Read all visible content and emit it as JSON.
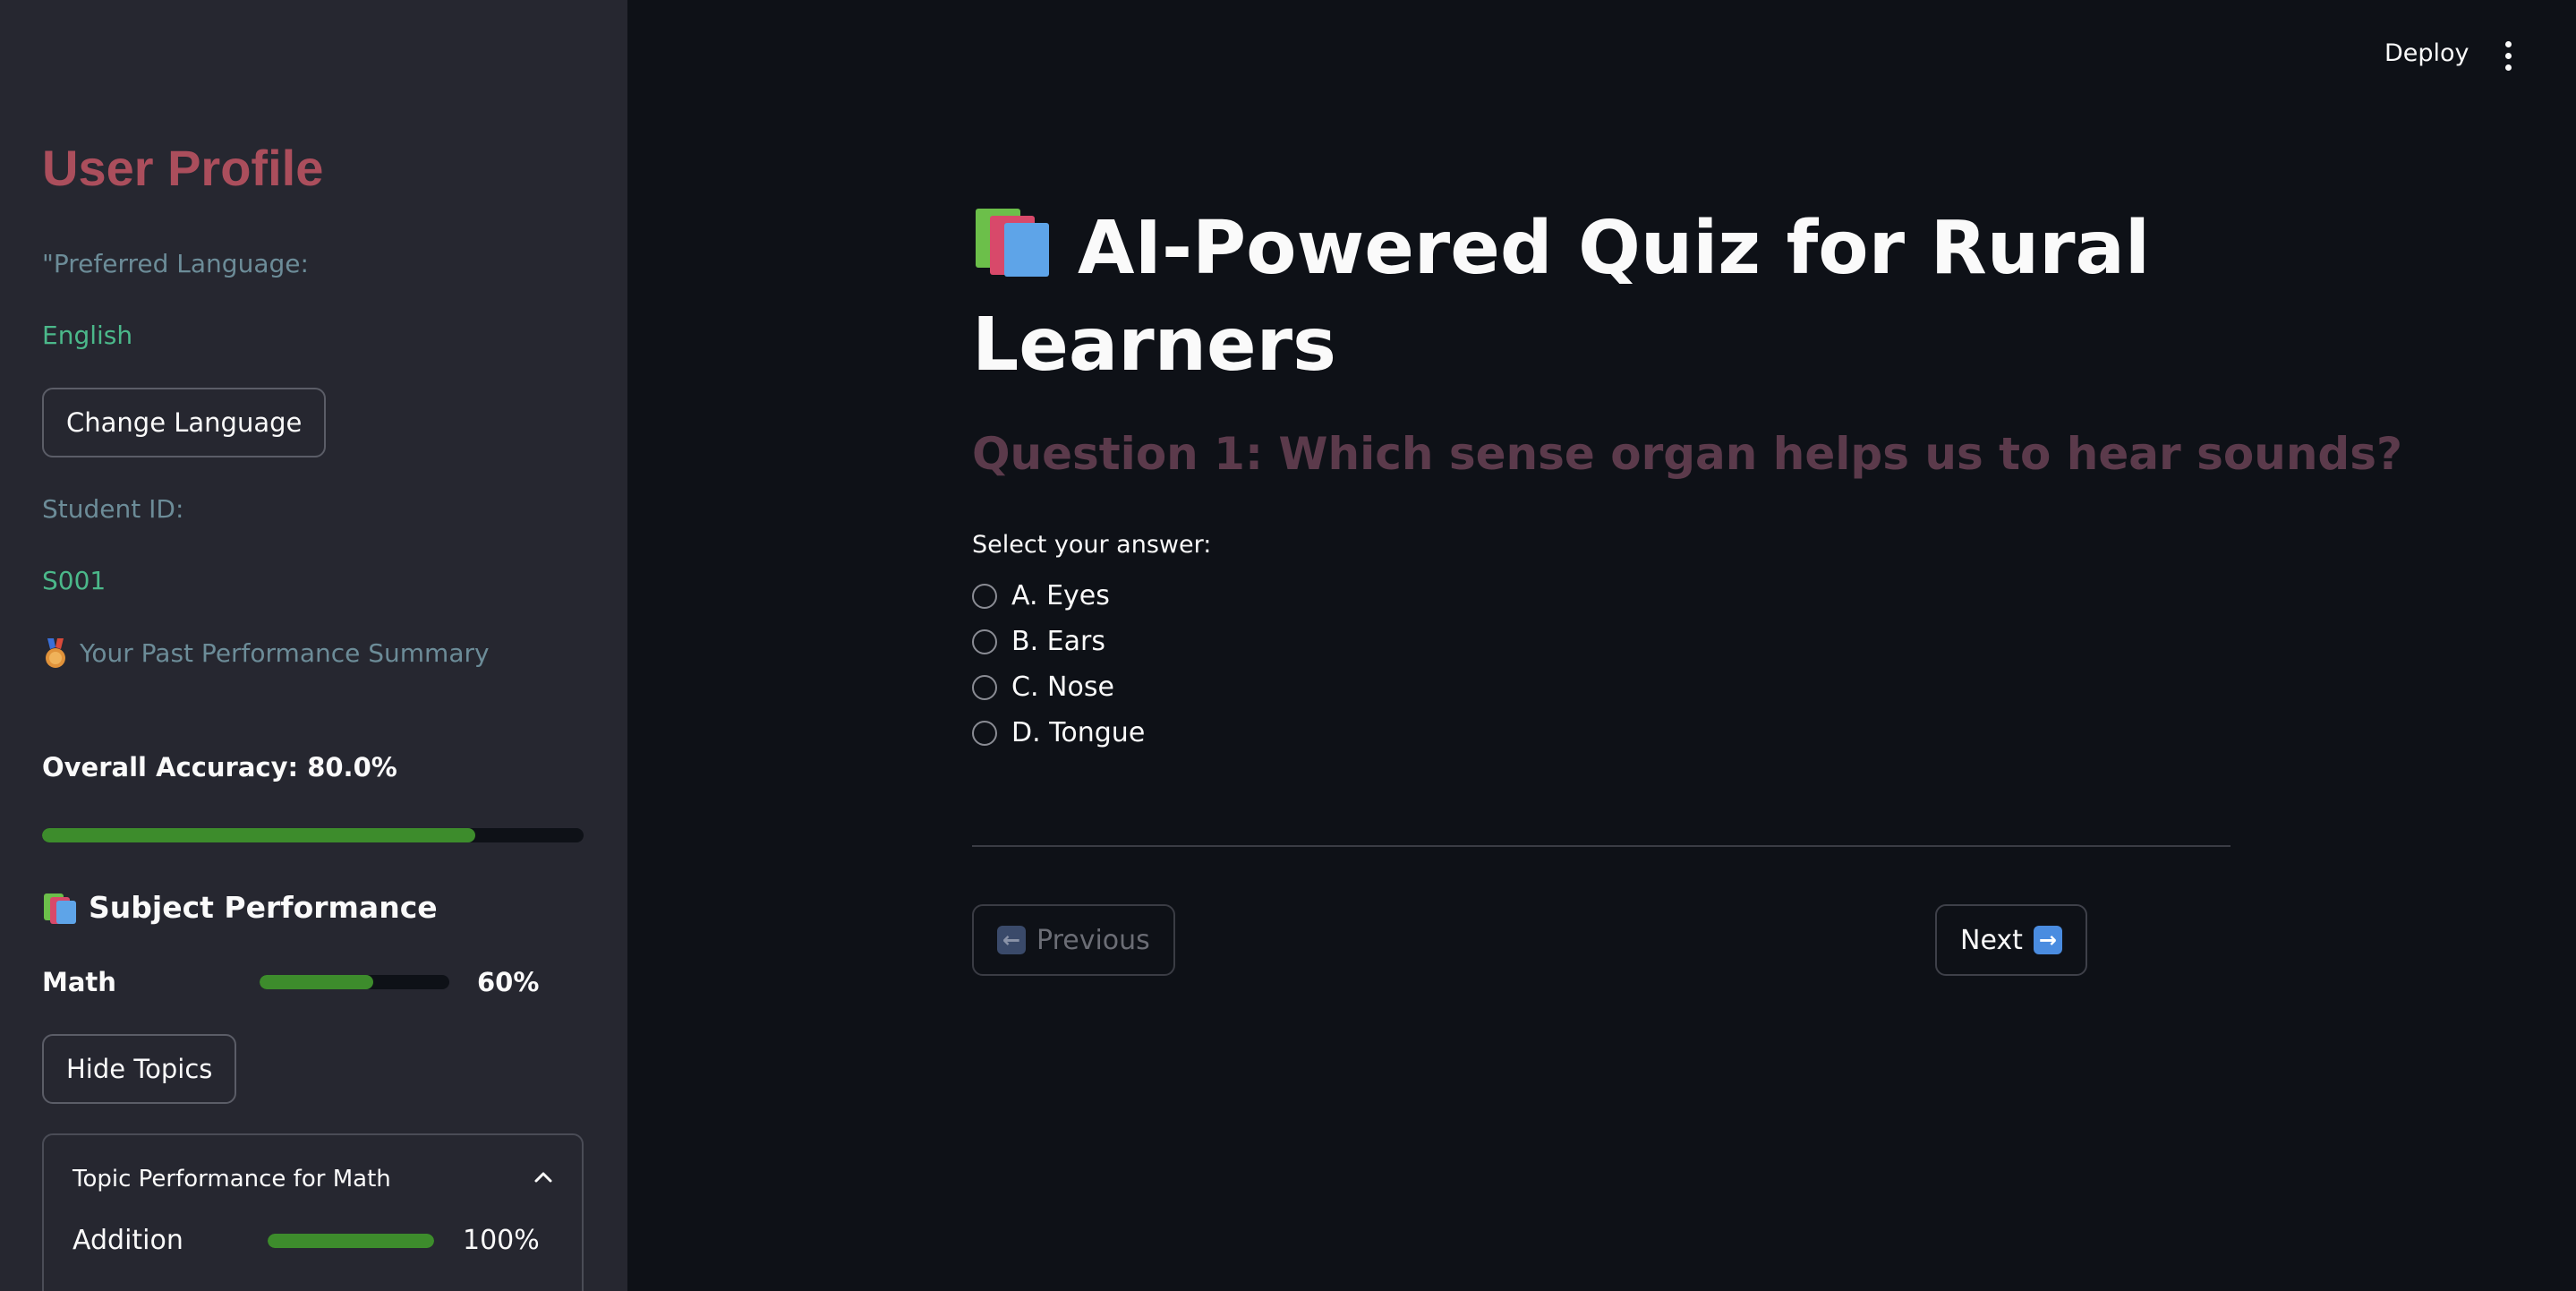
{
  "sidebar": {
    "title": "User Profile",
    "preferred_language_label": "\"Preferred Language:",
    "preferred_language_value": "English",
    "change_language_button": "Change Language",
    "student_id_label": "Student ID:",
    "student_id_value": "S001",
    "past_performance_label": "Your Past Performance Summary",
    "overall_accuracy_label": "Overall Accuracy: 80.0%",
    "overall_accuracy_progress": 0.8,
    "subject_performance_heading": "Subject Performance",
    "subjects": [
      {
        "name": "Math",
        "percent_label": "60%",
        "progress": 0.6
      }
    ],
    "hide_topics_button": "Hide Topics",
    "topic_expander": {
      "title": "Topic Performance for Math",
      "topics": [
        {
          "name": "Addition",
          "percent_label": "100%",
          "progress": 1.0
        }
      ]
    }
  },
  "header": {
    "deploy_label": "Deploy"
  },
  "main": {
    "title": "AI-Powered Quiz for Rural Learners",
    "question": "Question 1: Which sense organ helps us to hear sounds?",
    "select_label": "Select your answer:",
    "options": [
      "A. Eyes",
      "B. Ears",
      "C. Nose",
      "D. Tongue"
    ],
    "previous_button": "Previous",
    "next_button": "Next"
  },
  "colors": {
    "background": "#0e1117",
    "sidebar_bg": "#262730",
    "profile_title": "#ab4e5c",
    "question_text": "#5b3a4b",
    "progress_fill": "#3d8c2c",
    "accent_green_text": "#4bb88a"
  },
  "icons": {
    "title_icon": "books-icon",
    "performance_icon": "medal-icon",
    "previous_icon": "left-arrow-icon",
    "next_icon": "right-arrow-icon"
  }
}
